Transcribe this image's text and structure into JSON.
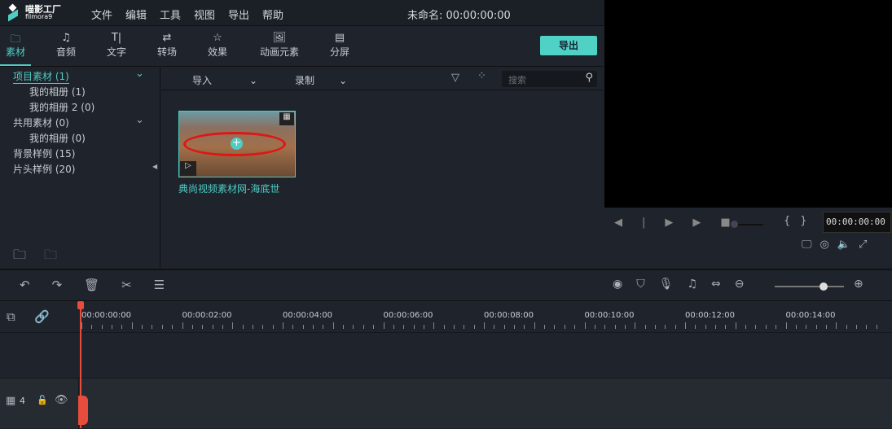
{
  "app": {
    "brand": "喵影工厂",
    "brand_sub": "filmora9",
    "title": "未命名: 00:00:00:00"
  },
  "menu": [
    "文件",
    "编辑",
    "工具",
    "视图",
    "导出",
    "帮助"
  ],
  "tabs": [
    "素材",
    "音频",
    "文字",
    "转场",
    "效果",
    "动画元素",
    "分屏"
  ],
  "export_label": "导出",
  "sidebar": [
    {
      "label": "项目素材 (1)",
      "indent": 0,
      "active": true,
      "chev": true
    },
    {
      "label": "我的相册 (1)",
      "indent": 1
    },
    {
      "label": "我的相册 2 (0)",
      "indent": 1
    },
    {
      "label": "共用素材 (0)",
      "indent": 0,
      "chev": true
    },
    {
      "label": "我的相册 (0)",
      "indent": 1
    },
    {
      "label": "背景样例 (15)",
      "indent": 0
    },
    {
      "label": "片头样例 (20)",
      "indent": 0
    }
  ],
  "media": {
    "import": "导入",
    "record": "录制",
    "search_placeholder": "搜索",
    "clip_name": "典尚视频素材网-海底世"
  },
  "player": {
    "timecode": "00:00:00:00"
  },
  "ruler": [
    "00:00:00:00",
    "00:00:02:00",
    "00:00:04:00",
    "00:00:06:00",
    "00:00:08:00",
    "00:00:10:00",
    "00:00:12:00",
    "00:00:14:00"
  ],
  "track": {
    "number": "4"
  },
  "colors": {
    "accent": "#4ecdc4",
    "playhead": "#e84c3d"
  }
}
